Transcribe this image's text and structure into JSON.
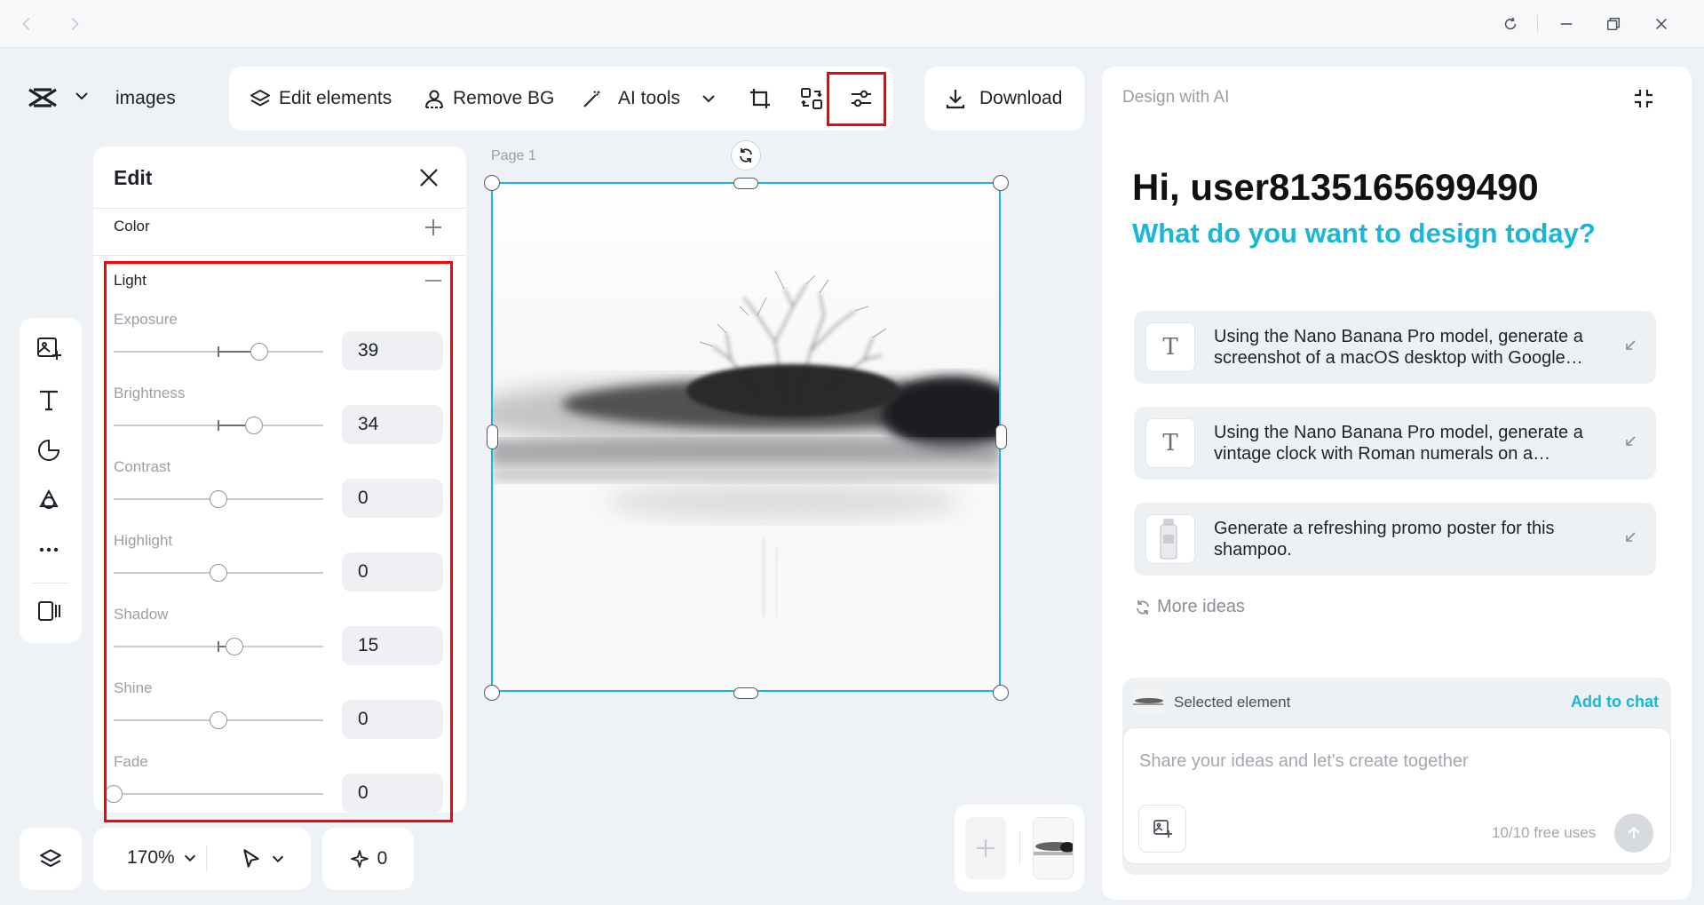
{
  "titlebar": {
    "back_icon": "chevron-left-icon",
    "forward_icon": "chevron-right-icon",
    "refresh_icon": "refresh-icon",
    "minimize_icon": "minimize-icon",
    "restore_icon": "restore-icon",
    "close_icon": "close-icon"
  },
  "header": {
    "logo": "capcut-logo",
    "project_name": "images"
  },
  "toolbar": {
    "edit_elements": "Edit elements",
    "remove_bg": "Remove BG",
    "ai_tools": "AI tools",
    "download": "Download"
  },
  "edit_panel": {
    "title": "Edit",
    "color_label": "Color",
    "light_label": "Light",
    "sliders": [
      {
        "label": "Exposure",
        "value": "39",
        "fraction": 0.695
      },
      {
        "label": "Brightness",
        "value": "34",
        "fraction": 0.67
      },
      {
        "label": "Contrast",
        "value": "0",
        "fraction": 0.5
      },
      {
        "label": "Highlight",
        "value": "0",
        "fraction": 0.5
      },
      {
        "label": "Shadow",
        "value": "15",
        "fraction": 0.575
      },
      {
        "label": "Shine",
        "value": "0",
        "fraction": 0.5
      },
      {
        "label": "Fade",
        "value": "0",
        "fraction": 0.0
      }
    ]
  },
  "canvas": {
    "page_label": "Page 1"
  },
  "bottom_bar": {
    "zoom": "170%",
    "ai_count": "0"
  },
  "ai_panel": {
    "title": "Design with AI",
    "greeting": "Hi, user8135165699490",
    "subtitle": "What do you want to design today?",
    "suggestions": [
      {
        "text": "Using the Nano Banana Pro model, generate a screenshot of a macOS desktop with Google…",
        "thumb": "T"
      },
      {
        "text": "Using the Nano Banana Pro model, generate a vintage clock with Roman numerals on a…",
        "thumb": "T"
      },
      {
        "text": "Generate a refreshing promo poster for this shampoo.",
        "thumb": ""
      }
    ],
    "more_ideas": "More ideas",
    "selected_element": "Selected element",
    "add_to_chat": "Add to chat",
    "input_placeholder": "Share your ideas and let's create together",
    "free_uses": "10/10 free uses"
  },
  "colors": {
    "accent": "#19b7d6",
    "highlight": "#ff0000",
    "selection": "#19b7d6"
  }
}
